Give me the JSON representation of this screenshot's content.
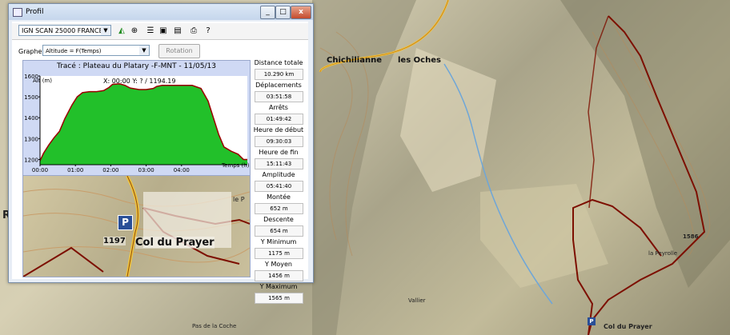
{
  "window": {
    "title": "Profil",
    "controls": {
      "minimize": "_",
      "maximize": "□",
      "close": "x"
    }
  },
  "toolbar": {
    "map_select": "IGN SCAN 25000 FRANCE",
    "icons": [
      "profile-icon",
      "zoom-icon",
      "list-icon",
      "export-icon",
      "save-icon",
      "print-icon",
      "help-icon"
    ]
  },
  "graph_controls": {
    "label": "Graphe",
    "selected": "Altitude = F(Temps)",
    "rotation_label": "Rotation"
  },
  "chart_title": "Tracé : Plateau du Platary -F-MNT - 11/05/13",
  "chart_readout": "X: 00:00 Y: ? / 1194.19",
  "chart_data": {
    "type": "area",
    "ylabel": "Alt (m)",
    "xlabel": "Temps (h)",
    "ylim": [
      1175,
      1600
    ],
    "yticks": [
      "1600",
      "1500",
      "1400",
      "1300",
      "1200"
    ],
    "xticks": [
      "00:00",
      "01:00",
      "02:00",
      "03:00",
      "04:00"
    ],
    "x_hours": [
      0.0,
      0.1,
      0.25,
      0.4,
      0.55,
      0.7,
      0.9,
      1.05,
      1.2,
      1.4,
      1.6,
      1.8,
      1.95,
      2.05,
      2.25,
      2.4,
      2.55,
      2.8,
      3.0,
      3.2,
      3.3,
      3.45,
      3.7,
      4.0,
      4.3,
      4.55,
      4.75,
      4.9,
      5.05,
      5.2,
      5.4,
      5.6,
      5.75,
      5.86
    ],
    "altitude_m": [
      1194,
      1230,
      1270,
      1305,
      1335,
      1395,
      1460,
      1500,
      1520,
      1525,
      1525,
      1530,
      1545,
      1560,
      1562,
      1555,
      1542,
      1535,
      1535,
      1540,
      1550,
      1555,
      1555,
      1555,
      1555,
      1540,
      1480,
      1400,
      1320,
      1260,
      1240,
      1225,
      1200,
      1200
    ],
    "fill_color": "#22c02a",
    "line_color": "#9b0000",
    "grid": false
  },
  "minimap": {
    "parking": "P",
    "altitude": "1197",
    "place": "Col du Prayer",
    "label_le": "le P"
  },
  "stats": [
    {
      "label": "Distance totale",
      "value": "10.290 km"
    },
    {
      "label": "Déplacements",
      "value": "03:51:58"
    },
    {
      "label": "Arrêts",
      "value": "01:49:42"
    },
    {
      "label": "Heure de début",
      "value": "09:30:03"
    },
    {
      "label": "Heure de fin",
      "value": "15:11:43"
    },
    {
      "label": "Amplitude",
      "value": "05:41:40"
    },
    {
      "label": "Montée",
      "value": "652 m"
    },
    {
      "label": "Descente",
      "value": "654 m"
    },
    {
      "label": "Y Minimum",
      "value": "1175 m"
    },
    {
      "label": "Y Moyen",
      "value": "1456 m"
    },
    {
      "label": "Y Maximum",
      "value": "1565 m"
    }
  ],
  "map_labels": {
    "village": "Chichilianne",
    "hamlet": "les Oches",
    "col": "Col du Prayer",
    "parking": "P",
    "alt_1586": "1586",
    "alt_1197": "1197",
    "bottom_right": "Col du Prayer",
    "bottom_left": "Pas de la Coche",
    "peyrolle": "la Peyrolle",
    "vallier": "Vallier"
  }
}
